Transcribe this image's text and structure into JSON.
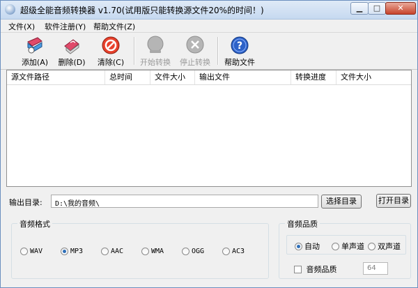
{
  "window": {
    "title": "超级全能音频转换器 v1.70(试用版只能转换源文件20%的时间！)"
  },
  "menu": [
    "文件(X)",
    "软件注册(Y)",
    "帮助文件(Z)"
  ],
  "toolbar": {
    "add": "添加(A)",
    "delete": "删除(D)",
    "clear": "清除(C)",
    "start": "开始转换",
    "stop": "停止转换",
    "help": "帮助文件"
  },
  "list": {
    "columns": [
      "源文件路径",
      "总时间",
      "文件大小",
      "输出文件",
      "转换进度",
      "文件大小"
    ]
  },
  "output": {
    "label": "输出目录:",
    "value": "D:\\我的音频\\",
    "choose_button": "选择目录",
    "open_button": "打开目录"
  },
  "format": {
    "title": "音频格式",
    "options": [
      "WAV",
      "MP3",
      "AAC",
      "WMA",
      "OGG",
      "AC3"
    ],
    "selected": "MP3"
  },
  "quality": {
    "title": "音频品质",
    "channels": [
      "自动",
      "单声道",
      "双声道"
    ],
    "selected_channel": "自动",
    "checkbox_label": "音频品质",
    "value": "64"
  },
  "colors": {
    "accent": "#2f6fb8",
    "close": "#c7432b"
  }
}
